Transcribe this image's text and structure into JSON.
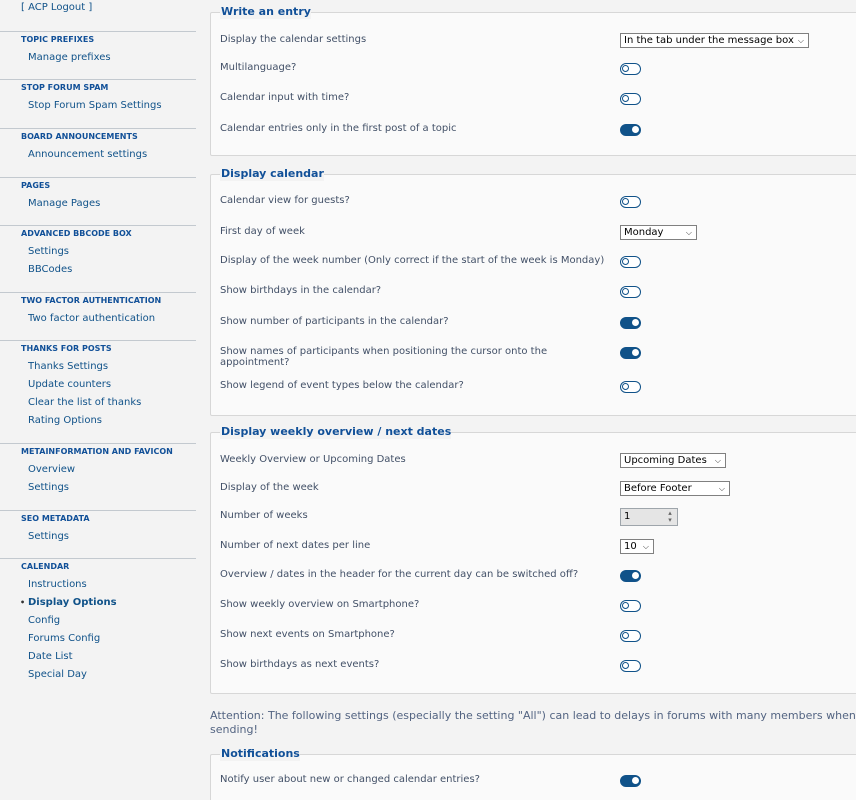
{
  "sidebar": {
    "logout": "[ ACP Logout ]",
    "sections": [
      {
        "title": "TOPIC PREFIXES",
        "items": [
          "Manage prefixes"
        ]
      },
      {
        "title": "STOP FORUM SPAM",
        "items": [
          "Stop Forum Spam Settings"
        ]
      },
      {
        "title": "BOARD ANNOUNCEMENTS",
        "items": [
          "Announcement settings"
        ]
      },
      {
        "title": "PAGES",
        "items": [
          "Manage Pages"
        ]
      },
      {
        "title": "ADVANCED BBCODE BOX",
        "items": [
          "Settings",
          "BBCodes"
        ]
      },
      {
        "title": "TWO FACTOR AUTHENTICATION",
        "items": [
          "Two factor authentication"
        ]
      },
      {
        "title": "THANKS FOR POSTS",
        "items": [
          "Thanks Settings",
          "Update counters",
          "Clear the list of thanks",
          "Rating Options"
        ]
      },
      {
        "title": "METAINFORMATION AND FAVICON",
        "items": [
          "Overview",
          "Settings"
        ]
      },
      {
        "title": "SEO METADATA",
        "items": [
          "Settings"
        ]
      },
      {
        "title": "CALENDAR",
        "items": [
          "Instructions",
          "Display Options",
          "Config",
          "Forums Config",
          "Date List",
          "Special Day"
        ]
      }
    ],
    "active_item": "Display Options"
  },
  "write_entry": {
    "legend": "Write an entry",
    "display_settings_label": "Display the calendar settings",
    "display_settings_value": "In the tab under the message box",
    "multilanguage_label": "Multilanguage?",
    "multilanguage_on": false,
    "input_time_label": "Calendar input with time?",
    "input_time_on": false,
    "first_post_label": "Calendar entries only in the first post of a topic",
    "first_post_on": true
  },
  "display_calendar": {
    "legend": "Display calendar",
    "guests_label": "Calendar view for guests?",
    "guests_on": false,
    "first_day_label": "First day of week",
    "first_day_value": "Monday",
    "week_number_label": "Display of the week number (Only correct if the start of the week is Monday)",
    "week_number_on": false,
    "birthdays_label": "Show birthdays in the calendar?",
    "birthdays_on": false,
    "participants_label": "Show number of participants in the calendar?",
    "participants_on": true,
    "names_label": "Show names of participants when positioning the cursor onto the appointment?",
    "names_on": true,
    "legend_types_label": "Show legend of event types below the calendar?",
    "legend_types_on": false
  },
  "weekly": {
    "legend": "Display weekly overview / next dates",
    "overview_label": "Weekly Overview or Upcoming Dates",
    "overview_value": "Upcoming Dates",
    "display_week_label": "Display of the week",
    "display_week_value": "Before Footer",
    "num_weeks_label": "Number of weeks",
    "num_weeks_value": "1",
    "next_dates_label": "Number of next dates per line",
    "next_dates_value": "10",
    "header_off_label": "Overview / dates in the header for the current day can be switched off?",
    "header_off_on": true,
    "smartphone_weekly_label": "Show weekly overview on Smartphone?",
    "smartphone_weekly_on": false,
    "smartphone_events_label": "Show next events on Smartphone?",
    "smartphone_events_on": false,
    "birthdays_next_label": "Show birthdays as next events?",
    "birthdays_next_on": false
  },
  "attention_text": "Attention: The following settings (especially the setting \"All\") can lead to delays in forums with many members when sending!",
  "notifications": {
    "legend": "Notifications",
    "notify_label": "Notify user about new or changed calendar entries?",
    "notify_on": true
  },
  "colors": {
    "accent": "#105289",
    "heading": "#115098",
    "background": "#f3f3f3"
  }
}
